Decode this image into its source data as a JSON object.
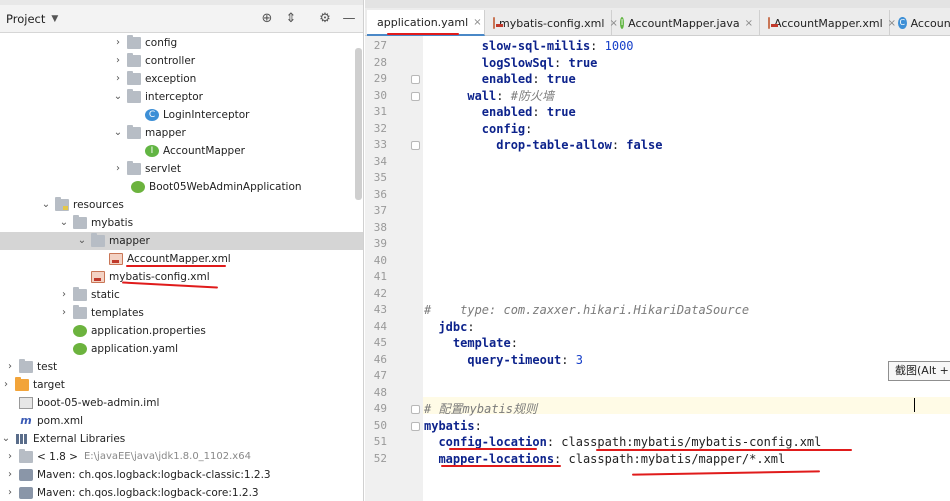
{
  "project_panel": {
    "title": "Project",
    "items": [
      {
        "label": "config",
        "icon": "folder-icon",
        "arrow": "›"
      },
      {
        "label": "controller",
        "icon": "folder-icon",
        "arrow": "›"
      },
      {
        "label": "exception",
        "icon": "folder-icon",
        "arrow": "›"
      },
      {
        "label": "interceptor",
        "icon": "folder-icon",
        "arrow": "⌄"
      },
      {
        "label": "LoginInterceptor",
        "icon": "class-icon"
      },
      {
        "label": "mapper",
        "icon": "folder-icon",
        "arrow": "⌄"
      },
      {
        "label": "AccountMapper",
        "icon": "interface-icon"
      },
      {
        "label": "servlet",
        "icon": "folder-icon",
        "arrow": "›"
      },
      {
        "label": "Boot05WebAdminApplication",
        "icon": "spring-boot-icon"
      },
      {
        "label": "resources",
        "icon": "resources-folder-icon",
        "arrow": "⌄"
      },
      {
        "label": "mybatis",
        "icon": "folder-icon",
        "arrow": "⌄"
      },
      {
        "label": "mapper",
        "icon": "folder-icon",
        "arrow": "⌄"
      },
      {
        "label": "AccountMapper.xml",
        "icon": "xml-icon"
      },
      {
        "label": "mybatis-config.xml",
        "icon": "xml-icon"
      },
      {
        "label": "static",
        "icon": "folder-icon",
        "arrow": "›"
      },
      {
        "label": "templates",
        "icon": "folder-icon",
        "arrow": "›"
      },
      {
        "label": "application.properties",
        "icon": "spring-config-icon"
      },
      {
        "label": "application.yaml",
        "icon": "spring-config-icon"
      },
      {
        "label": "test",
        "icon": "folder-icon",
        "arrow": "›"
      },
      {
        "label": "target",
        "icon": "folder-orange-icon",
        "arrow": "›"
      },
      {
        "label": "boot-05-web-admin.iml",
        "icon": "iml-file-icon"
      },
      {
        "label": "pom.xml",
        "icon": "maven-icon"
      },
      {
        "label": "External Libraries",
        "icon": "library-icon",
        "arrow": "⌄"
      },
      {
        "label": "< 1.8 >",
        "extra": "E:\\javaEE\\java\\jdk1.8.0_1102.x64",
        "icon": "jdk-icon",
        "arrow": "›"
      },
      {
        "label": "Maven: ch.qos.logback:logback-classic:1.2.3",
        "icon": "jar-icon",
        "arrow": "›"
      },
      {
        "label": "Maven: ch.qos.logback:logback-core:1.2.3",
        "icon": "jar-icon",
        "arrow": "›"
      }
    ]
  },
  "tabs": [
    {
      "label": "application.yaml",
      "icon": "yaml-icon"
    },
    {
      "label": "mybatis-config.xml",
      "icon": "xml-icon"
    },
    {
      "label": "AccountMapper.java",
      "icon": "interface-icon"
    },
    {
      "label": "AccountMapper.xml",
      "icon": "xml-icon"
    },
    {
      "label": "Account",
      "icon": "class-icon"
    }
  ],
  "editor": {
    "line_numbers": [
      "27",
      "28",
      "29",
      "30",
      "31",
      "32",
      "33",
      "34",
      "35",
      "36",
      "37",
      "38",
      "39",
      "40",
      "41",
      "42",
      "43",
      "44",
      "45",
      "46",
      "47",
      "48",
      "49",
      "50",
      "51",
      "52"
    ],
    "lines": [
      {
        "indent": "        ",
        "key": "slow-sql-millis",
        "sep": ": ",
        "val": "1000",
        "vclass": "n"
      },
      {
        "indent": "        ",
        "key": "logSlowSql",
        "sep": ": ",
        "val": "true",
        "vclass": "v"
      },
      {
        "indent": "        ",
        "key": "enabled",
        "sep": ": ",
        "val": "true",
        "vclass": "v"
      },
      {
        "indent": "      ",
        "key": "wall",
        "sep": ": ",
        "val": "#防火墙",
        "vclass": "c"
      },
      {
        "indent": "        ",
        "key": "enabled",
        "sep": ": ",
        "val": "true",
        "vclass": "v"
      },
      {
        "indent": "        ",
        "key": "config",
        "sep": ":",
        "val": "",
        "vclass": "p"
      },
      {
        "indent": "          ",
        "key": "drop-table-allow",
        "sep": ": ",
        "val": "false",
        "vclass": "v"
      },
      {
        "indent": "",
        "key": "",
        "sep": "",
        "val": "",
        "vclass": "p"
      },
      {
        "indent": "",
        "key": "",
        "sep": "",
        "val": "",
        "vclass": "p"
      },
      {
        "indent": "",
        "key": "",
        "sep": "",
        "val": "",
        "vclass": "p"
      },
      {
        "indent": "",
        "key": "",
        "sep": "",
        "val": "",
        "vclass": "p"
      },
      {
        "indent": "",
        "key": "",
        "sep": "",
        "val": "",
        "vclass": "p"
      },
      {
        "indent": "",
        "key": "",
        "sep": "",
        "val": "",
        "vclass": "p"
      },
      {
        "indent": "",
        "key": "",
        "sep": "",
        "val": "",
        "vclass": "p"
      },
      {
        "indent": "",
        "key": "",
        "sep": "",
        "val": "",
        "vclass": "p"
      },
      {
        "indent": "",
        "key": "",
        "sep": "",
        "val": "",
        "vclass": "p"
      },
      {
        "indent": "",
        "key": "",
        "sep": "",
        "val": "#    type: com.zaxxer.hikari.HikariDataSource",
        "vclass": "c"
      },
      {
        "indent": "  ",
        "key": "jdbc",
        "sep": ":",
        "val": "",
        "vclass": "p"
      },
      {
        "indent": "    ",
        "key": "template",
        "sep": ":",
        "val": "",
        "vclass": "p"
      },
      {
        "indent": "      ",
        "key": "query-timeout",
        "sep": ": ",
        "val": "3",
        "vclass": "n"
      },
      {
        "indent": "",
        "key": "",
        "sep": "",
        "val": "",
        "vclass": "p"
      },
      {
        "indent": "",
        "key": "",
        "sep": "",
        "val": "",
        "vclass": "p"
      },
      {
        "indent": "",
        "key": "",
        "sep": "",
        "val": "# 配置mybatis规则",
        "vclass": "c"
      },
      {
        "indent": "",
        "key": "mybatis",
        "sep": ":",
        "val": "",
        "vclass": "p"
      },
      {
        "indent": "  ",
        "key": "config-location",
        "sep": ": ",
        "val": "classpath:mybatis/mybatis-config.xml",
        "vclass": "p"
      },
      {
        "indent": "  ",
        "key": "mapper-locations",
        "sep": ": ",
        "val": "classpath:mybatis/mapper/*.xml",
        "vclass": "p"
      }
    ]
  },
  "tooltip": "截图(Alt + A)"
}
